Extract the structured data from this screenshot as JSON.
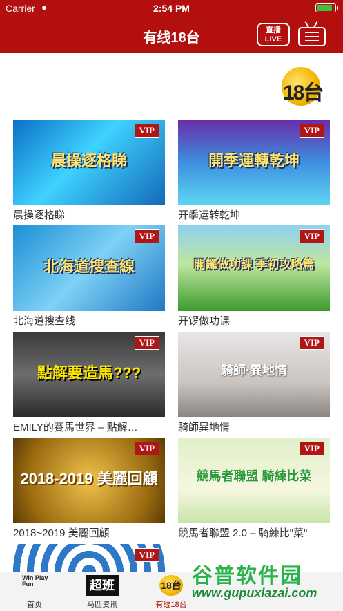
{
  "status": {
    "carrier": "Carrier",
    "time": "2:54 PM"
  },
  "nav": {
    "title": "有线18台",
    "live_top": "直播",
    "live_bottom": "LIVE"
  },
  "logo": {
    "text": "18台"
  },
  "cards": [
    {
      "label": "晨操逐格睇",
      "art": "晨操逐格睇",
      "vip": "VIP"
    },
    {
      "label": "开季运转乾坤",
      "art": "開季運轉乾坤",
      "vip": "VIP"
    },
    {
      "label": "北海道搜查线",
      "art": "北海道搜查線",
      "vip": "VIP"
    },
    {
      "label": "开锣做功课",
      "art": "開鑼做功課 季初攻略篇",
      "vip": "VIP"
    },
    {
      "label": "EMILY的賽馬世界 – 點解…",
      "art": "點解要造馬???",
      "vip": "VIP"
    },
    {
      "label": "騎師異地情",
      "art": "騎師·異地情",
      "vip": "VIP"
    },
    {
      "label": "2018~2019 美麗回顧",
      "art": "2018-2019 美麗回顧",
      "vip": "VIP"
    },
    {
      "label": "競馬者聯盟 2.0 – 騎練比\"菜\"",
      "art": "競馬者聯盟 騎練比菜",
      "vip": "VIP"
    },
    {
      "label": "",
      "art": "",
      "vip": "VIP"
    }
  ],
  "tabs": [
    {
      "label": "首页",
      "icon_text": "Win Play Fun"
    },
    {
      "label": "马匹资讯",
      "icon_text": "超班"
    },
    {
      "label": "有线18台",
      "icon_text": "18台"
    }
  ],
  "watermark": {
    "title": "谷普软件园",
    "url": "www.gupuxlazai.com"
  },
  "colors": {
    "brand_red": "#b30f0f",
    "vip_red": "#b01616",
    "tab_active": "#b30f0f"
  }
}
